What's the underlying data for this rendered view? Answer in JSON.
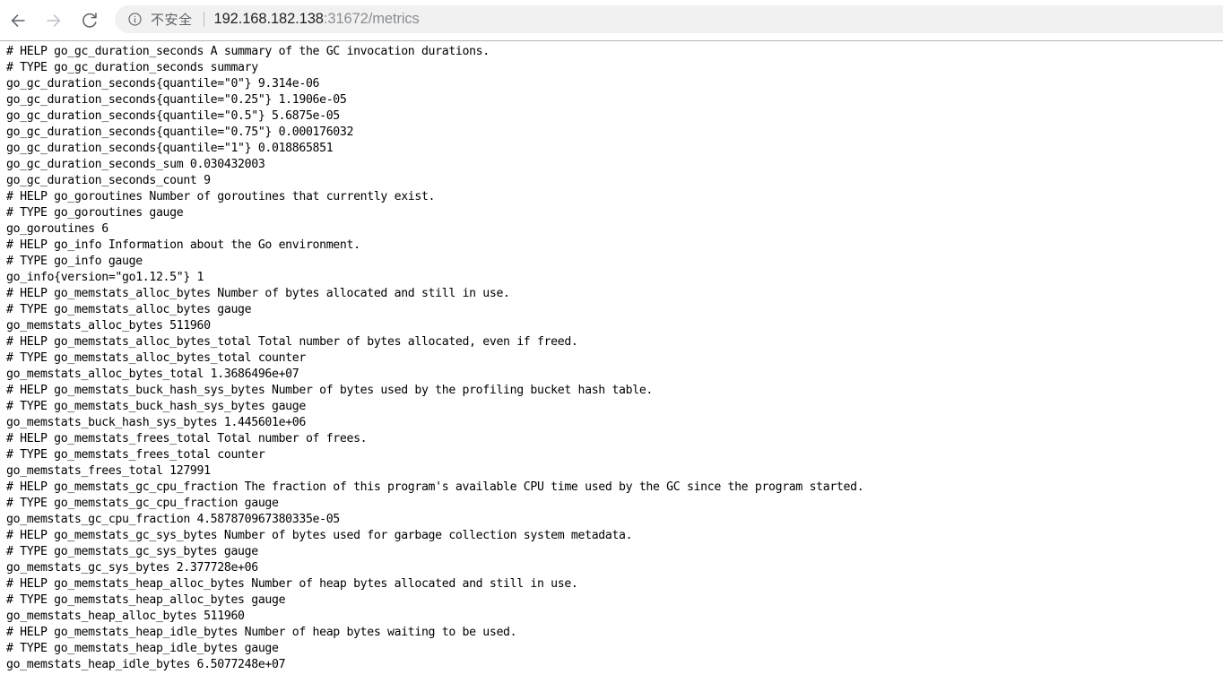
{
  "browser": {
    "nav": {
      "back_icon": "arrow-left-icon",
      "forward_icon": "arrow-right-icon",
      "reload_icon": "reload-icon",
      "back_enabled": true,
      "forward_enabled": false
    },
    "omnibox": {
      "info_icon": "info-circle-icon",
      "security_label": "不安全",
      "url_host": "192.168.182.138",
      "url_rest": ":31672/metrics",
      "full_url": "192.168.182.138:31672/metrics"
    },
    "colors": {
      "omnibox_bg": "#f1f1f1",
      "security_text": "#5f6368",
      "url_host_text": "#202124",
      "url_rest_text": "#8a8d91",
      "toolbar_border": "#b6b6b6",
      "page_bg": "#ffffff",
      "page_text": "#000000"
    }
  },
  "page": {
    "content_type": "prometheus-metrics-plaintext",
    "lines": [
      "# HELP go_gc_duration_seconds A summary of the GC invocation durations.",
      "# TYPE go_gc_duration_seconds summary",
      "go_gc_duration_seconds{quantile=\"0\"} 9.314e-06",
      "go_gc_duration_seconds{quantile=\"0.25\"} 1.1906e-05",
      "go_gc_duration_seconds{quantile=\"0.5\"} 5.6875e-05",
      "go_gc_duration_seconds{quantile=\"0.75\"} 0.000176032",
      "go_gc_duration_seconds{quantile=\"1\"} 0.018865851",
      "go_gc_duration_seconds_sum 0.030432003",
      "go_gc_duration_seconds_count 9",
      "# HELP go_goroutines Number of goroutines that currently exist.",
      "# TYPE go_goroutines gauge",
      "go_goroutines 6",
      "# HELP go_info Information about the Go environment.",
      "# TYPE go_info gauge",
      "go_info{version=\"go1.12.5\"} 1",
      "# HELP go_memstats_alloc_bytes Number of bytes allocated and still in use.",
      "# TYPE go_memstats_alloc_bytes gauge",
      "go_memstats_alloc_bytes 511960",
      "# HELP go_memstats_alloc_bytes_total Total number of bytes allocated, even if freed.",
      "# TYPE go_memstats_alloc_bytes_total counter",
      "go_memstats_alloc_bytes_total 1.3686496e+07",
      "# HELP go_memstats_buck_hash_sys_bytes Number of bytes used by the profiling bucket hash table.",
      "# TYPE go_memstats_buck_hash_sys_bytes gauge",
      "go_memstats_buck_hash_sys_bytes 1.445601e+06",
      "# HELP go_memstats_frees_total Total number of frees.",
      "# TYPE go_memstats_frees_total counter",
      "go_memstats_frees_total 127991",
      "# HELP go_memstats_gc_cpu_fraction The fraction of this program's available CPU time used by the GC since the program started.",
      "# TYPE go_memstats_gc_cpu_fraction gauge",
      "go_memstats_gc_cpu_fraction 4.587870967380335e-05",
      "# HELP go_memstats_gc_sys_bytes Number of bytes used for garbage collection system metadata.",
      "# TYPE go_memstats_gc_sys_bytes gauge",
      "go_memstats_gc_sys_bytes 2.377728e+06",
      "# HELP go_memstats_heap_alloc_bytes Number of heap bytes allocated and still in use.",
      "# TYPE go_memstats_heap_alloc_bytes gauge",
      "go_memstats_heap_alloc_bytes 511960",
      "# HELP go_memstats_heap_idle_bytes Number of heap bytes waiting to be used.",
      "# TYPE go_memstats_heap_idle_bytes gauge",
      "go_memstats_heap_idle_bytes 6.5077248e+07"
    ]
  }
}
